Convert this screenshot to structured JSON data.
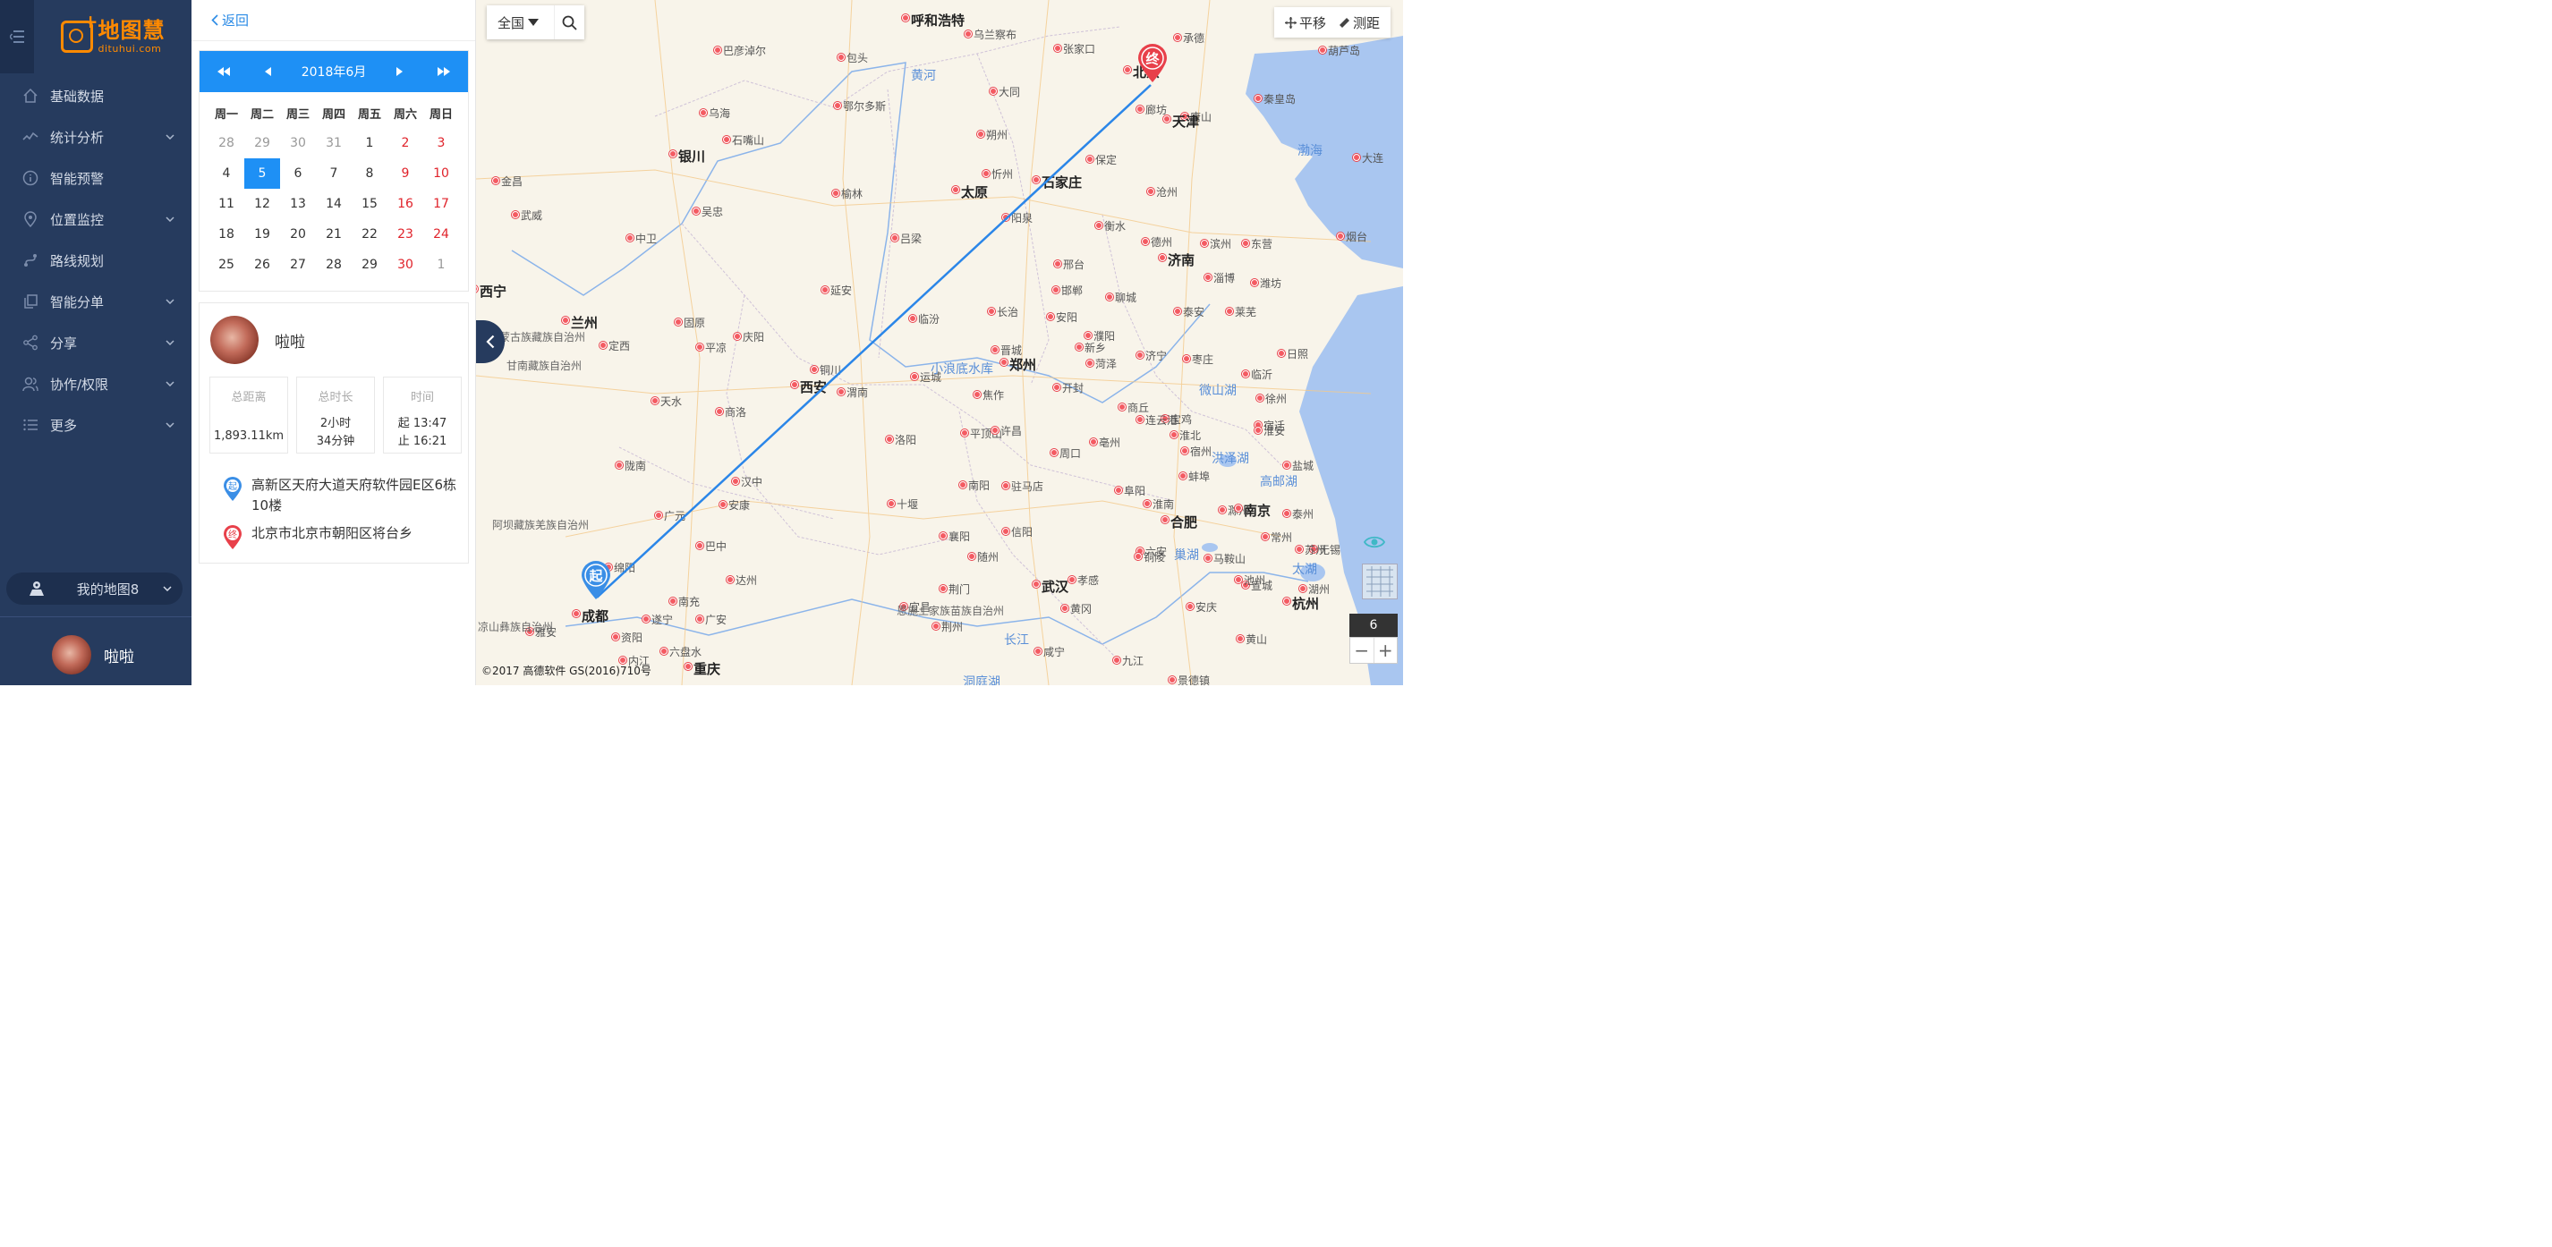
{
  "brand": {
    "name_cn": "地图慧",
    "name_en": "dituhui.com"
  },
  "sidebar": {
    "items": [
      {
        "label": "基础数据",
        "icon": "home-icon",
        "has_caret": false
      },
      {
        "label": "统计分析",
        "icon": "chart-line-icon",
        "has_caret": true
      },
      {
        "label": "智能预警",
        "icon": "info-icon",
        "has_caret": false
      },
      {
        "label": "位置监控",
        "icon": "location-pin-icon",
        "has_caret": true
      },
      {
        "label": "路线规划",
        "icon": "route-icon",
        "has_caret": false
      },
      {
        "label": "智能分单",
        "icon": "copy-icon",
        "has_caret": true
      },
      {
        "label": "分享",
        "icon": "share-icon",
        "has_caret": true
      },
      {
        "label": "协作/权限",
        "icon": "users-icon",
        "has_caret": true
      },
      {
        "label": "更多",
        "icon": "list-icon",
        "has_caret": true
      }
    ],
    "my_map": "我的地图8",
    "user_name": "啦啦"
  },
  "panel": {
    "back_label": "返回",
    "calendar": {
      "title": "2018年6月",
      "weekdays": [
        "周一",
        "周二",
        "周三",
        "周四",
        "周五",
        "周六",
        "周日"
      ],
      "days": [
        {
          "d": "28",
          "muted": true
        },
        {
          "d": "29",
          "muted": true
        },
        {
          "d": "30",
          "muted": true
        },
        {
          "d": "31",
          "muted": true
        },
        {
          "d": "1"
        },
        {
          "d": "2",
          "weekend": true
        },
        {
          "d": "3",
          "weekend": true
        },
        {
          "d": "4"
        },
        {
          "d": "5",
          "selected": true
        },
        {
          "d": "6"
        },
        {
          "d": "7"
        },
        {
          "d": "8"
        },
        {
          "d": "9",
          "weekend": true
        },
        {
          "d": "10",
          "weekend": true
        },
        {
          "d": "11"
        },
        {
          "d": "12"
        },
        {
          "d": "13"
        },
        {
          "d": "14"
        },
        {
          "d": "15"
        },
        {
          "d": "16",
          "weekend": true
        },
        {
          "d": "17",
          "weekend": true
        },
        {
          "d": "18"
        },
        {
          "d": "19"
        },
        {
          "d": "20"
        },
        {
          "d": "21"
        },
        {
          "d": "22"
        },
        {
          "d": "23",
          "weekend": true
        },
        {
          "d": "24",
          "weekend": true
        },
        {
          "d": "25"
        },
        {
          "d": "26"
        },
        {
          "d": "27"
        },
        {
          "d": "28"
        },
        {
          "d": "29"
        },
        {
          "d": "30",
          "weekend": true
        },
        {
          "d": "1",
          "muted": true
        }
      ]
    },
    "trip": {
      "user_name": "啦啦",
      "distance_label": "总距离",
      "distance_value": "1,893.11km",
      "duration_label": "总时长",
      "duration_line1": "2小时",
      "duration_line2": "34分钟",
      "time_label": "时间",
      "time_start": "起 13:47",
      "time_end": "止 16:21",
      "start_pin": "起",
      "end_pin": "终",
      "start_address": "高新区天府大道天府软件园E区6栋10楼",
      "end_address": "北京市北京市朝阳区将台乡"
    }
  },
  "map": {
    "search_region": "全国",
    "tool_pan": "平移",
    "tool_measure": "测距",
    "zoom_level": "6",
    "zoom_out": "−",
    "zoom_in": "+",
    "copyright": "©2017 高德软件 GS(2016)710号",
    "start_marker": "起",
    "end_marker": "终",
    "route_color": "#2b86e8",
    "cities_big": [
      "呼和浩特",
      "银川",
      "太原",
      "石家庄",
      "北京",
      "天津",
      "济南",
      "西宁",
      "兰州",
      "郑州",
      "西安",
      "南京",
      "合肥",
      "武汉",
      "成都",
      "重庆",
      "杭州"
    ],
    "cities_small": [
      "巴彦淖尔",
      "乌兰察布",
      "张家口",
      "承德",
      "葫芦岛",
      "包头",
      "大同",
      "乌海",
      "鄂尔多斯",
      "朔州",
      "廊坊",
      "唐山",
      "秦皇岛",
      "石嘴山",
      "忻州",
      "保定",
      "金昌",
      "榆林",
      "沧州",
      "大连",
      "武威",
      "吴忠",
      "阳泉",
      "衡水",
      "中卫",
      "吕梁",
      "德州",
      "滨州",
      "东营",
      "烟台",
      "淄博",
      "潍坊",
      "邢台",
      "延安",
      "长治",
      "邯郸",
      "泰安",
      "莱芜",
      "临汾",
      "聊城",
      "固原",
      "庆阳",
      "平凉",
      "安阳",
      "定西",
      "新乡",
      "晋城",
      "濮阳",
      "济宁",
      "枣庄",
      "临沂",
      "日照",
      "铜川",
      "菏泽",
      "运城",
      "焦作",
      "开封",
      "天水",
      "渭南",
      "洛阳",
      "商丘",
      "宝鸡",
      "徐州",
      "连云港",
      "淮北",
      "宿迁",
      "商洛",
      "平顶山",
      "许昌",
      "亳州",
      "宿州",
      "淮安",
      "陇南",
      "周口",
      "汉中",
      "蚌埠",
      "盐城",
      "十堰",
      "南阳",
      "驻马店",
      "阜阳",
      "淮南",
      "广元",
      "滁州",
      "泰州",
      "巴中",
      "信阳",
      "六安",
      "马鞍山",
      "无锡",
      "绵阳",
      "襄阳",
      "随州",
      "荆门",
      "孝感",
      "铜陵",
      "宣城",
      "湖州",
      "达州",
      "南充",
      "宜昌",
      "黄冈",
      "安庆",
      "池州",
      "黄山",
      "遂宁",
      "广安",
      "资阳",
      "荆州",
      "咸宁",
      "九江",
      "景德镇",
      "雅安",
      "内江",
      "常州",
      "苏州",
      "安康",
      "六盘水"
    ],
    "water_labels": [
      "黄河",
      "渤海",
      "小浪底水库",
      "微山湖",
      "洪泽湖",
      "高邮湖",
      "巢湖",
      "太湖",
      "长江",
      "洞庭湖"
    ],
    "region_labels": [
      "海西蒙古族藏族自治州",
      "甘南藏族自治州",
      "阿坝藏族羌族自治州",
      "恩施土家族苗族自治州",
      "凉山彝族自治州"
    ]
  }
}
